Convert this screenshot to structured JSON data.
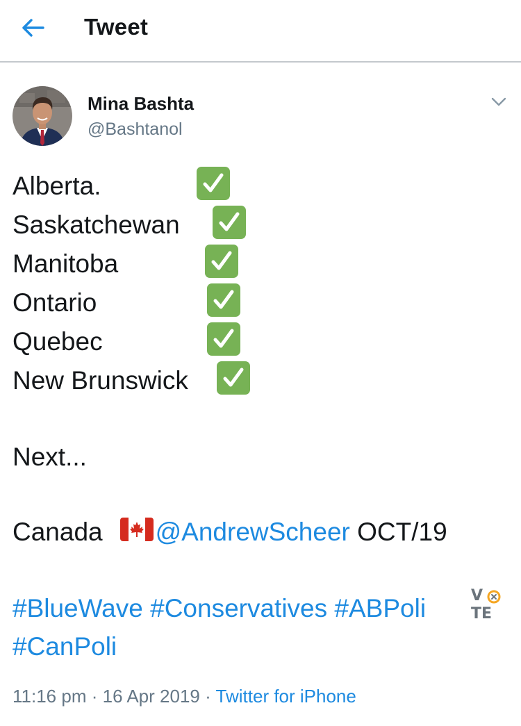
{
  "header": {
    "back_icon": "arrow-left-icon",
    "title": "Tweet"
  },
  "tweet": {
    "author_name": "Mina Bashta",
    "author_handle": "@Bashtanol",
    "menu_icon": "chevron-down-icon",
    "provinces": [
      "Alberta.",
      "Saskatchewan",
      "Manitoba",
      "Ontario",
      "Quebec",
      "New Brunswick"
    ],
    "check_icon": "white-heavy-check-mark-icon",
    "next_text": "Next...",
    "canada_text": "Canada",
    "flag_icon": "canada-flag-icon",
    "mention": "@AndrewScheer",
    "date_text": "OCT/19",
    "hashtags": [
      "#BlueWave",
      "#Conservatives",
      "#ABPoli",
      "#CanPoli"
    ],
    "vote_badge": {
      "v": "V",
      "te": "TE"
    },
    "time": "11:16 pm",
    "separator": "·",
    "date": "16 Apr 2019",
    "source": "Twitter for iPhone"
  },
  "colors": {
    "link": "#1d8ae0",
    "check_bg": "#77b255",
    "secondary_text": "#657786",
    "vote_accent": "#f5a623"
  }
}
